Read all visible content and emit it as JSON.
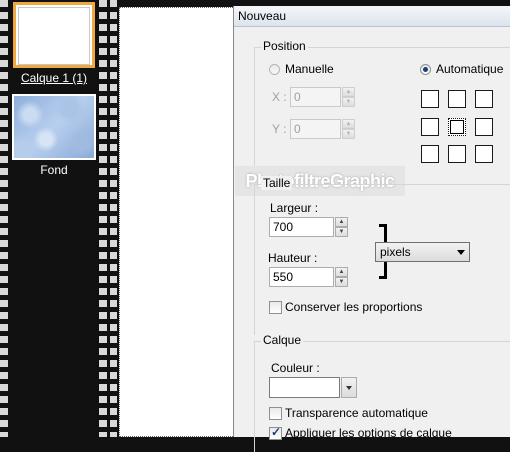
{
  "layers_panel": {
    "layers": [
      {
        "name": "Calque 1 (1)",
        "selected": true
      },
      {
        "name": "Fond",
        "selected": false
      }
    ]
  },
  "dialog": {
    "title": "Nouveau",
    "watermark": "PhotofiltreGraphic",
    "position": {
      "legend": "Position",
      "manual_label": "Manuelle",
      "auto_label": "Automatique",
      "mode": "Automatique",
      "x_label": "X :",
      "y_label": "Y :",
      "x_value": "0",
      "y_value": "0",
      "anchor_selected": "center"
    },
    "taille": {
      "legend": "Taille",
      "width_label": "Largeur :",
      "width_value": "700",
      "height_label": "Hauteur :",
      "height_value": "550",
      "unit": "pixels",
      "keep_ratio_label": "Conserver les proportions",
      "keep_ratio": false
    },
    "calque": {
      "legend": "Calque",
      "color_label": "Couleur :",
      "color_value": "#ffffff",
      "auto_transparency_label": "Transparence automatique",
      "auto_transparency": false,
      "apply_options_label": "Appliquer les options de calque",
      "apply_options": true
    }
  },
  "colors": {
    "selection_border": "#f0a840",
    "panel_bg": "#111111",
    "dialog_bg": "#f0f0f0"
  }
}
